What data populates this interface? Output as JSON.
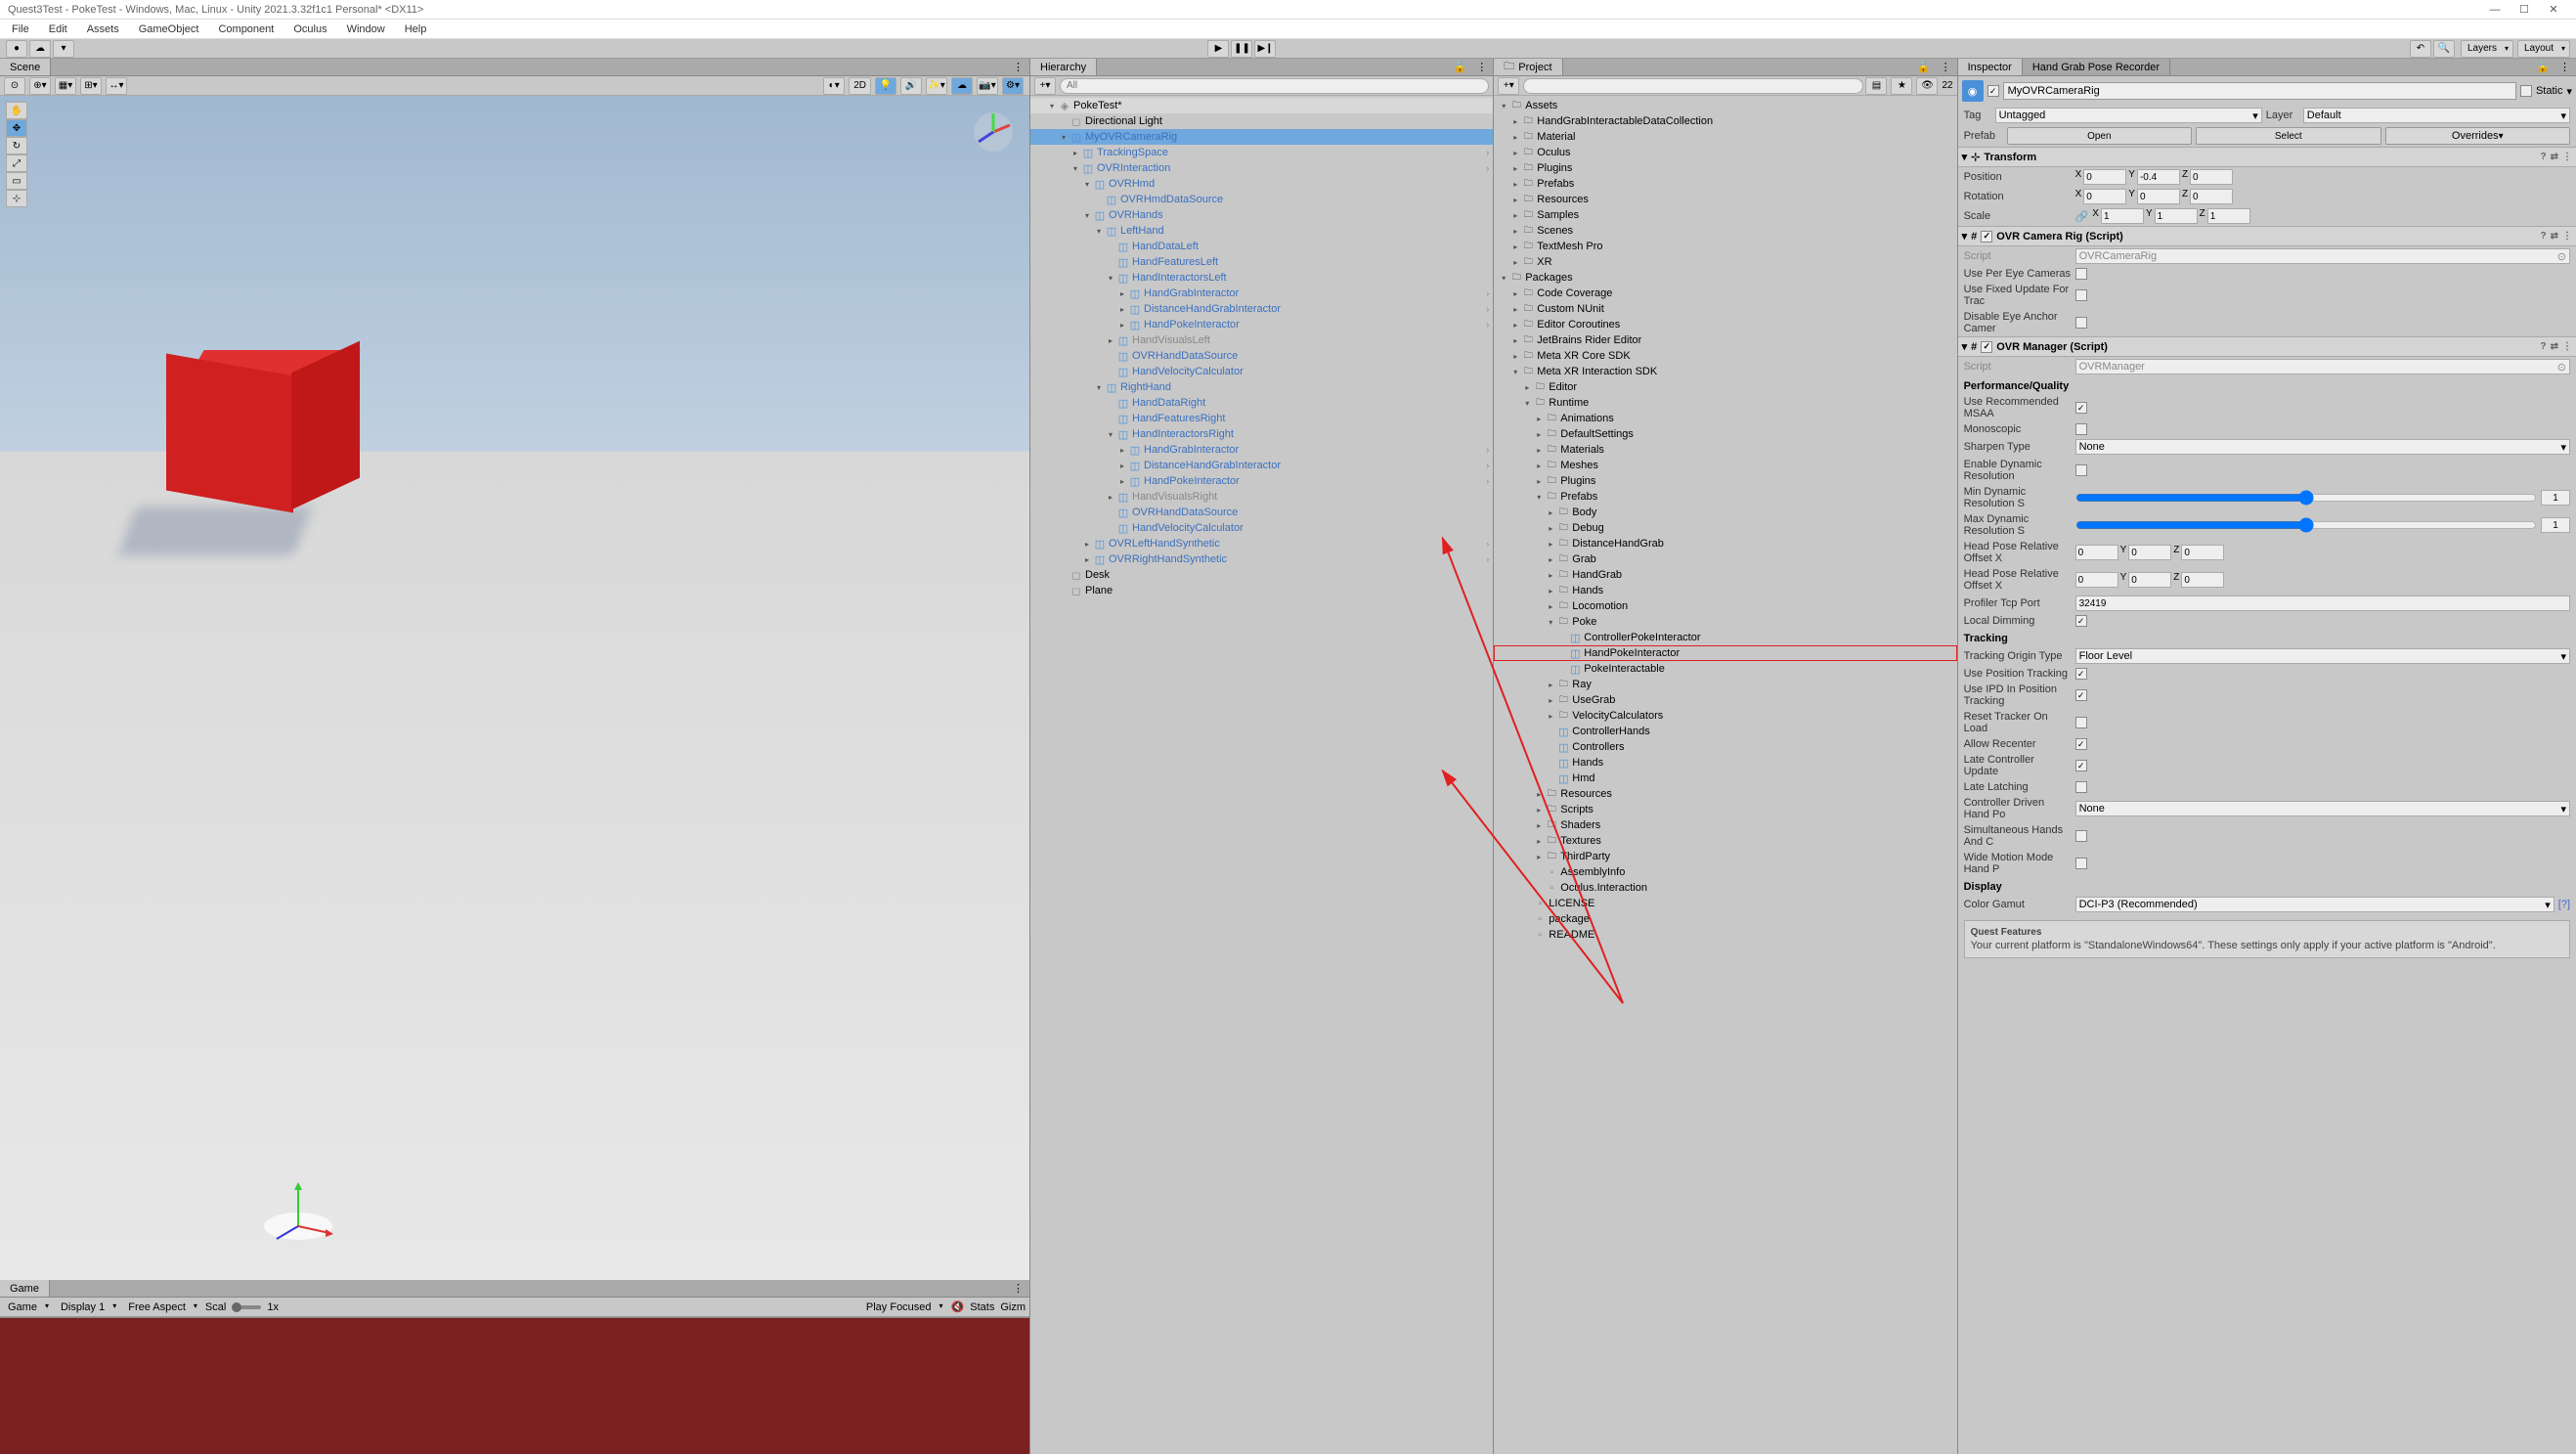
{
  "title": "Quest3Test - PokeTest - Windows, Mac, Linux - Unity 2021.3.32f1c1 Personal* <DX11>",
  "menu": [
    "File",
    "Edit",
    "Assets",
    "GameObject",
    "Component",
    "Oculus",
    "Window",
    "Help"
  ],
  "layout_dd": "Layout",
  "layers_dd": "Layers",
  "scene_tab": "Scene",
  "game_tab": "Game",
  "hierarchy_tab": "Hierarchy",
  "project_tab": "Project",
  "inspector_tab": "Inspector",
  "handgrab_tab": "Hand Grab Pose Recorder",
  "search_placeholder": "All",
  "scene_2d": "2D",
  "game": {
    "game_dd": "Game",
    "display": "Display 1",
    "aspect": "Free Aspect",
    "scale_label": "Scal",
    "scale_val": "1x",
    "playfocused": "Play Focused",
    "stats": "Stats",
    "gizmos": "Gizm"
  },
  "hierarchy": {
    "scene": "PokeTest*",
    "items": [
      {
        "d": 1,
        "f": "▾",
        "i": "scene",
        "t": "PokeTest*",
        "cls": "hi"
      },
      {
        "d": 2,
        "f": "",
        "i": "cube-gray",
        "t": "Directional Light"
      },
      {
        "d": 2,
        "f": "▾",
        "i": "prefab",
        "t": "MyOVRCameraRig",
        "cls": "label-blue selected"
      },
      {
        "d": 3,
        "f": "▸",
        "i": "prefab",
        "t": "TrackingSpace",
        "cls": "label-blue",
        "arr": true
      },
      {
        "d": 3,
        "f": "▾",
        "i": "prefab",
        "t": "OVRInteraction",
        "cls": "label-blue",
        "arr": true
      },
      {
        "d": 4,
        "f": "▾",
        "i": "prefab",
        "t": "OVRHmd",
        "cls": "label-blue"
      },
      {
        "d": 5,
        "f": "",
        "i": "prefab",
        "t": "OVRHmdDataSource",
        "cls": "label-blue"
      },
      {
        "d": 4,
        "f": "▾",
        "i": "prefab",
        "t": "OVRHands",
        "cls": "label-blue"
      },
      {
        "d": 5,
        "f": "▾",
        "i": "prefab",
        "t": "LeftHand",
        "cls": "label-blue"
      },
      {
        "d": 6,
        "f": "",
        "i": "prefab",
        "t": "HandDataLeft",
        "cls": "label-blue"
      },
      {
        "d": 6,
        "f": "",
        "i": "prefab",
        "t": "HandFeaturesLeft",
        "cls": "label-blue"
      },
      {
        "d": 6,
        "f": "▾",
        "i": "prefab",
        "t": "HandInteractorsLeft",
        "cls": "label-blue"
      },
      {
        "d": 7,
        "f": "▸",
        "i": "prefab",
        "t": "HandGrabInteractor",
        "cls": "label-blue",
        "arr": true
      },
      {
        "d": 7,
        "f": "▸",
        "i": "prefab",
        "t": "DistanceHandGrabInteractor",
        "cls": "label-blue",
        "arr": true
      },
      {
        "d": 7,
        "f": "▸",
        "i": "prefab",
        "t": "HandPokeInteractor",
        "cls": "label-blue",
        "arr": true
      },
      {
        "d": 6,
        "f": "▸",
        "i": "prefab",
        "t": "HandVisualsLeft",
        "cls": "label-gray"
      },
      {
        "d": 6,
        "f": "",
        "i": "prefab",
        "t": "OVRHandDataSource",
        "cls": "label-blue"
      },
      {
        "d": 6,
        "f": "",
        "i": "prefab",
        "t": "HandVelocityCalculator",
        "cls": "label-blue"
      },
      {
        "d": 5,
        "f": "▾",
        "i": "prefab",
        "t": "RightHand",
        "cls": "label-blue"
      },
      {
        "d": 6,
        "f": "",
        "i": "prefab",
        "t": "HandDataRight",
        "cls": "label-blue"
      },
      {
        "d": 6,
        "f": "",
        "i": "prefab",
        "t": "HandFeaturesRight",
        "cls": "label-blue"
      },
      {
        "d": 6,
        "f": "▾",
        "i": "prefab",
        "t": "HandInteractorsRight",
        "cls": "label-blue"
      },
      {
        "d": 7,
        "f": "▸",
        "i": "prefab",
        "t": "HandGrabInteractor",
        "cls": "label-blue",
        "arr": true
      },
      {
        "d": 7,
        "f": "▸",
        "i": "prefab",
        "t": "DistanceHandGrabInteractor",
        "cls": "label-blue",
        "arr": true
      },
      {
        "d": 7,
        "f": "▸",
        "i": "prefab",
        "t": "HandPokeInteractor",
        "cls": "label-blue",
        "arr": true
      },
      {
        "d": 6,
        "f": "▸",
        "i": "prefab",
        "t": "HandVisualsRight",
        "cls": "label-gray"
      },
      {
        "d": 6,
        "f": "",
        "i": "prefab",
        "t": "OVRHandDataSource",
        "cls": "label-blue"
      },
      {
        "d": 6,
        "f": "",
        "i": "prefab",
        "t": "HandVelocityCalculator",
        "cls": "label-blue"
      },
      {
        "d": 4,
        "f": "▸",
        "i": "prefab",
        "t": "OVRLeftHandSynthetic",
        "cls": "label-blue",
        "arr": true
      },
      {
        "d": 4,
        "f": "▸",
        "i": "prefab",
        "t": "OVRRightHandSynthetic",
        "cls": "label-blue",
        "arr": true
      },
      {
        "d": 2,
        "f": "",
        "i": "cube-gray",
        "t": "Desk"
      },
      {
        "d": 2,
        "f": "",
        "i": "cube-gray",
        "t": "Plane"
      }
    ]
  },
  "project": {
    "count": "22",
    "items": [
      {
        "d": 0,
        "f": "▾",
        "i": "folder",
        "t": "Assets"
      },
      {
        "d": 1,
        "f": "▸",
        "i": "folder",
        "t": "HandGrabInteractableDataCollection"
      },
      {
        "d": 1,
        "f": "▸",
        "i": "folder",
        "t": "Material"
      },
      {
        "d": 1,
        "f": "▸",
        "i": "folder",
        "t": "Oculus"
      },
      {
        "d": 1,
        "f": "▸",
        "i": "folder",
        "t": "Plugins"
      },
      {
        "d": 1,
        "f": "▸",
        "i": "folder",
        "t": "Prefabs"
      },
      {
        "d": 1,
        "f": "▸",
        "i": "folder",
        "t": "Resources"
      },
      {
        "d": 1,
        "f": "▸",
        "i": "folder",
        "t": "Samples"
      },
      {
        "d": 1,
        "f": "▸",
        "i": "folder",
        "t": "Scenes"
      },
      {
        "d": 1,
        "f": "▸",
        "i": "folder",
        "t": "TextMesh Pro"
      },
      {
        "d": 1,
        "f": "▸",
        "i": "folder",
        "t": "XR"
      },
      {
        "d": 0,
        "f": "▾",
        "i": "folder",
        "t": "Packages"
      },
      {
        "d": 1,
        "f": "▸",
        "i": "folder",
        "t": "Code Coverage"
      },
      {
        "d": 1,
        "f": "▸",
        "i": "folder",
        "t": "Custom NUnit"
      },
      {
        "d": 1,
        "f": "▸",
        "i": "folder",
        "t": "Editor Coroutines"
      },
      {
        "d": 1,
        "f": "▸",
        "i": "folder",
        "t": "JetBrains Rider Editor"
      },
      {
        "d": 1,
        "f": "▸",
        "i": "folder",
        "t": "Meta XR Core SDK"
      },
      {
        "d": 1,
        "f": "▾",
        "i": "folder",
        "t": "Meta XR Interaction SDK"
      },
      {
        "d": 2,
        "f": "▸",
        "i": "folder",
        "t": "Editor"
      },
      {
        "d": 2,
        "f": "▾",
        "i": "folder",
        "t": "Runtime"
      },
      {
        "d": 3,
        "f": "▸",
        "i": "folder",
        "t": "Animations"
      },
      {
        "d": 3,
        "f": "▸",
        "i": "folder",
        "t": "DefaultSettings"
      },
      {
        "d": 3,
        "f": "▸",
        "i": "folder",
        "t": "Materials"
      },
      {
        "d": 3,
        "f": "▸",
        "i": "folder",
        "t": "Meshes"
      },
      {
        "d": 3,
        "f": "▸",
        "i": "folder",
        "t": "Plugins"
      },
      {
        "d": 3,
        "f": "▾",
        "i": "folder",
        "t": "Prefabs"
      },
      {
        "d": 4,
        "f": "▸",
        "i": "folder",
        "t": "Body"
      },
      {
        "d": 4,
        "f": "▸",
        "i": "folder",
        "t": "Debug"
      },
      {
        "d": 4,
        "f": "▸",
        "i": "folder",
        "t": "DistanceHandGrab"
      },
      {
        "d": 4,
        "f": "▸",
        "i": "folder",
        "t": "Grab"
      },
      {
        "d": 4,
        "f": "▸",
        "i": "folder",
        "t": "HandGrab"
      },
      {
        "d": 4,
        "f": "▸",
        "i": "folder",
        "t": "Hands"
      },
      {
        "d": 4,
        "f": "▸",
        "i": "folder",
        "t": "Locomotion"
      },
      {
        "d": 4,
        "f": "▾",
        "i": "folder",
        "t": "Poke"
      },
      {
        "d": 5,
        "f": "",
        "i": "prefab",
        "t": "ControllerPokeInteractor"
      },
      {
        "d": 5,
        "f": "",
        "i": "prefab",
        "t": "HandPokeInteractor",
        "hl": true
      },
      {
        "d": 5,
        "f": "",
        "i": "prefab",
        "t": "PokeInteractable"
      },
      {
        "d": 4,
        "f": "▸",
        "i": "folder",
        "t": "Ray"
      },
      {
        "d": 4,
        "f": "▸",
        "i": "folder",
        "t": "UseGrab"
      },
      {
        "d": 4,
        "f": "▸",
        "i": "folder",
        "t": "VelocityCalculators"
      },
      {
        "d": 4,
        "f": "",
        "i": "prefab",
        "t": "ControllerHands"
      },
      {
        "d": 4,
        "f": "",
        "i": "prefab",
        "t": "Controllers"
      },
      {
        "d": 4,
        "f": "",
        "i": "prefab",
        "t": "Hands"
      },
      {
        "d": 4,
        "f": "",
        "i": "prefab",
        "t": "Hmd"
      },
      {
        "d": 3,
        "f": "▸",
        "i": "folder",
        "t": "Resources"
      },
      {
        "d": 3,
        "f": "▸",
        "i": "folder",
        "t": "Scripts"
      },
      {
        "d": 3,
        "f": "▸",
        "i": "folder",
        "t": "Shaders"
      },
      {
        "d": 3,
        "f": "▸",
        "i": "folder",
        "t": "Textures"
      },
      {
        "d": 3,
        "f": "▸",
        "i": "folder",
        "t": "ThirdParty"
      },
      {
        "d": 3,
        "f": "",
        "i": "file",
        "t": "AssemblyInfo"
      },
      {
        "d": 3,
        "f": "",
        "i": "file",
        "t": "Oculus.Interaction"
      },
      {
        "d": 2,
        "f": "",
        "i": "file",
        "t": "LICENSE"
      },
      {
        "d": 2,
        "f": "",
        "i": "file",
        "t": "package"
      },
      {
        "d": 2,
        "f": "",
        "i": "file",
        "t": "README"
      }
    ]
  },
  "inspector": {
    "name": "MyOVRCameraRig",
    "static": "Static",
    "tag_label": "Tag",
    "tag_val": "Untagged",
    "layer_label": "Layer",
    "layer_val": "Default",
    "prefab_label": "Prefab",
    "open_btn": "Open",
    "select_btn": "Select",
    "overrides_btn": "Overrides",
    "transform": {
      "title": "Transform",
      "position": "Position",
      "px": "0",
      "py": "-0.4",
      "pz": "0",
      "rotation": "Rotation",
      "rx": "0",
      "ry": "0",
      "rz": "0",
      "scale": "Scale",
      "sx": "1",
      "sy": "1",
      "sz": "1"
    },
    "camerarig": {
      "title": "OVR Camera Rig (Script)",
      "script_label": "Script",
      "script_val": "OVRCameraRig",
      "use_per_eye": "Use Per Eye Cameras",
      "use_fixed": "Use Fixed Update For Trac",
      "disable_eye": "Disable Eye Anchor Camer"
    },
    "manager": {
      "title": "OVR Manager (Script)",
      "script_label": "Script",
      "script_val": "OVRManager",
      "perf_title": "Performance/Quality",
      "use_msaa": "Use Recommended MSAA",
      "monoscopic": "Monoscopic",
      "sharpen": "Sharpen Type",
      "sharpen_val": "None",
      "dyn_res": "Enable Dynamic Resolution",
      "min_dyn": "Min Dynamic Resolution S",
      "min_val": "1",
      "max_dyn": "Max Dynamic Resolution S",
      "max_val": "1",
      "headpose1": "Head Pose Relative Offset X",
      "h1x": "0",
      "h1y": "0",
      "h1z": "0",
      "headpose2": "Head Pose Relative Offset X",
      "h2x": "0",
      "h2y": "0",
      "h2z": "0",
      "profiler": "Profiler Tcp Port",
      "profiler_val": "32419",
      "localdim": "Local Dimming",
      "tracking_title": "Tracking",
      "origin": "Tracking Origin Type",
      "origin_val": "Floor Level",
      "use_pos": "Use Position Tracking",
      "use_ipd": "Use IPD In Position Tracking",
      "reset_tracker": "Reset Tracker On Load",
      "recenter": "Allow Recenter",
      "late_ctrl": "Late Controller Update",
      "late_latch": "Late Latching",
      "ctrl_driven": "Controller Driven Hand Po",
      "ctrl_driven_val": "None",
      "sim_hands": "Simultaneous Hands And C",
      "wide_motion": "Wide Motion Mode Hand P",
      "display_title": "Display",
      "gamut": "Color Gamut",
      "gamut_val": "DCI-P3 (Recommended)",
      "quest_title": "Quest Features",
      "quest_info": "Your current platform is \"StandaloneWindows64\". These settings only apply if your active platform is \"Android\"."
    }
  }
}
